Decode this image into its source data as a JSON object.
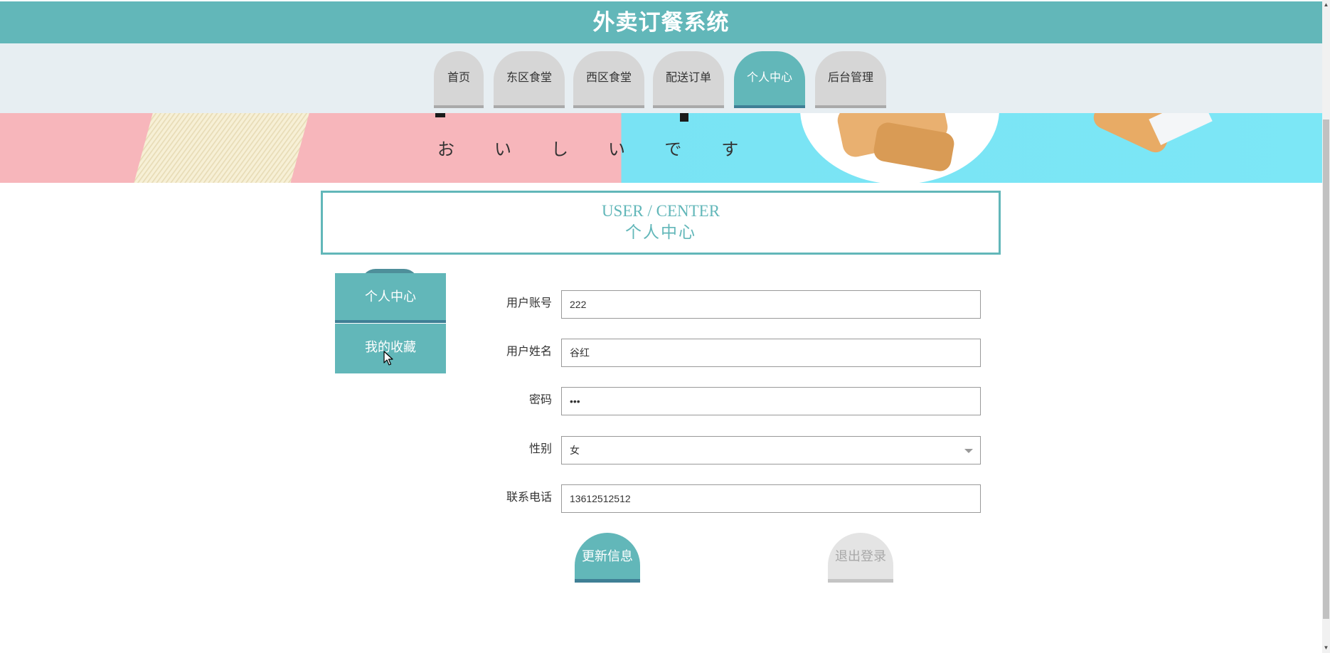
{
  "app": {
    "title": "外卖订餐系统"
  },
  "nav": {
    "tabs": [
      {
        "label": "首页",
        "active": false
      },
      {
        "label": "东区食堂",
        "active": false
      },
      {
        "label": "西区食堂",
        "active": false
      },
      {
        "label": "配送订单",
        "active": false
      },
      {
        "label": "个人中心",
        "active": true
      },
      {
        "label": "后台管理",
        "active": false
      }
    ]
  },
  "banner": {
    "caption": "おいしいです"
  },
  "section": {
    "title_en": "USER / CENTER",
    "title_cn": "个人中心"
  },
  "sidebar": {
    "items": [
      {
        "label": "个人中心"
      },
      {
        "label": "我的收藏"
      }
    ]
  },
  "form": {
    "account": {
      "label": "用户账号",
      "value": "222"
    },
    "name": {
      "label": "用户姓名",
      "value": "谷红"
    },
    "password": {
      "label": "密码",
      "value": "•••"
    },
    "gender": {
      "label": "性别",
      "value": "女"
    },
    "phone": {
      "label": "联系电话",
      "value": "13612512512"
    }
  },
  "actions": {
    "update_label": "更新信息",
    "logout_label": "退出登录"
  },
  "colors": {
    "primary": "#62b7b9",
    "primary_dark": "#3f7f95",
    "nav_bg": "#e7eef2",
    "tab_inactive": "#d6d6d6"
  }
}
